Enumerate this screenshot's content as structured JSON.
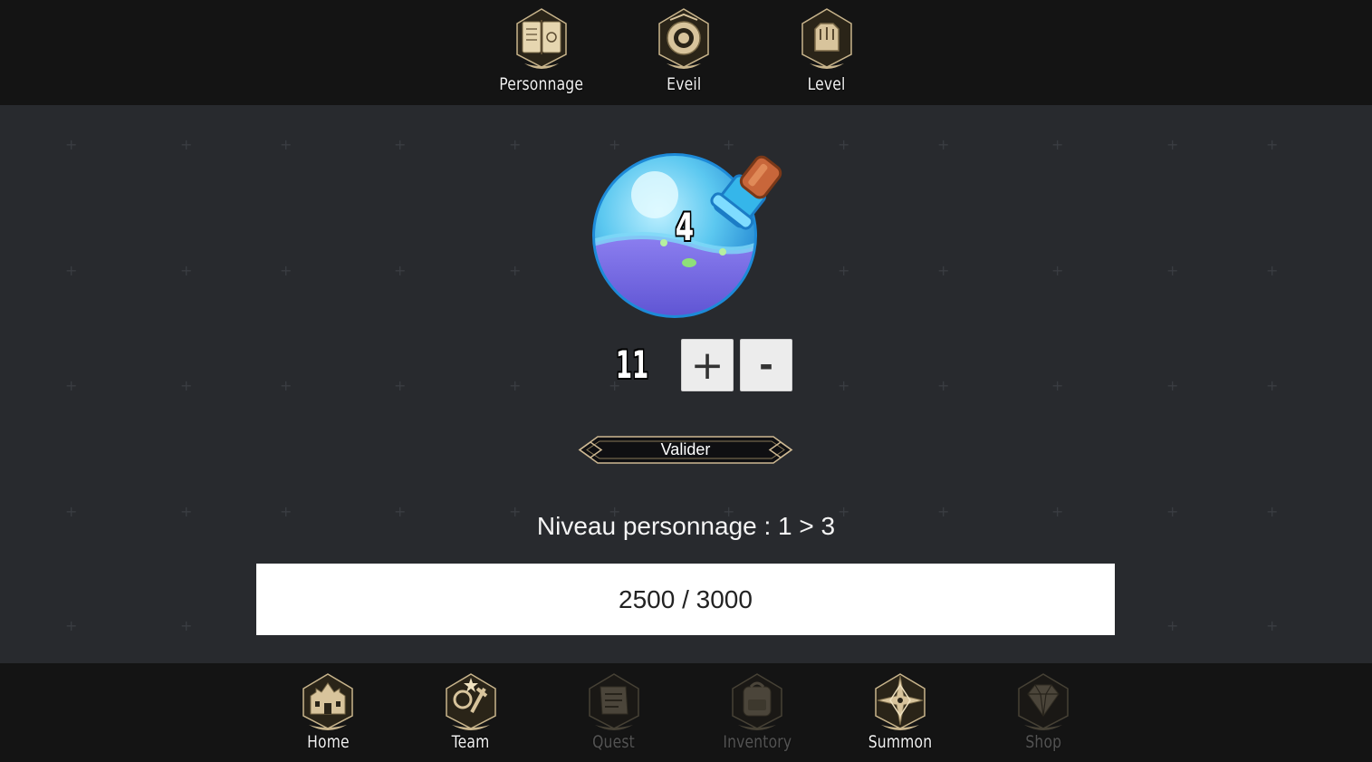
{
  "top_nav": [
    {
      "label": "Personnage",
      "icon": "book-icon"
    },
    {
      "label": "Eveil",
      "icon": "eye-emblem-icon"
    },
    {
      "label": "Level",
      "icon": "fist-icon"
    }
  ],
  "potion": {
    "count": "4",
    "icon": "potion-bottle-icon"
  },
  "quantity": {
    "value": "11",
    "plus_label": "+",
    "minus_label": "-"
  },
  "validate_label": "Valider",
  "level_text": "Niveau personnage : 1 > 3",
  "xp": {
    "text": "2500 / 3000",
    "current": 2500,
    "max": 3000
  },
  "bottom_nav": [
    {
      "label": "Home",
      "icon": "castle-icon",
      "enabled": true
    },
    {
      "label": "Team",
      "icon": "team-icon",
      "enabled": true
    },
    {
      "label": "Quest",
      "icon": "scroll-icon",
      "enabled": false
    },
    {
      "label": "Inventory",
      "icon": "backpack-icon",
      "enabled": false
    },
    {
      "label": "Summon",
      "icon": "star-icon",
      "enabled": true
    },
    {
      "label": "Shop",
      "icon": "diamond-icon",
      "enabled": false
    }
  ],
  "colors": {
    "background": "#282a2e",
    "nav_bar": "#141414",
    "icon_gold": "#d8c49c",
    "potion_blue": "#4fc3ea",
    "potion_liquid": "#6b6be0"
  }
}
